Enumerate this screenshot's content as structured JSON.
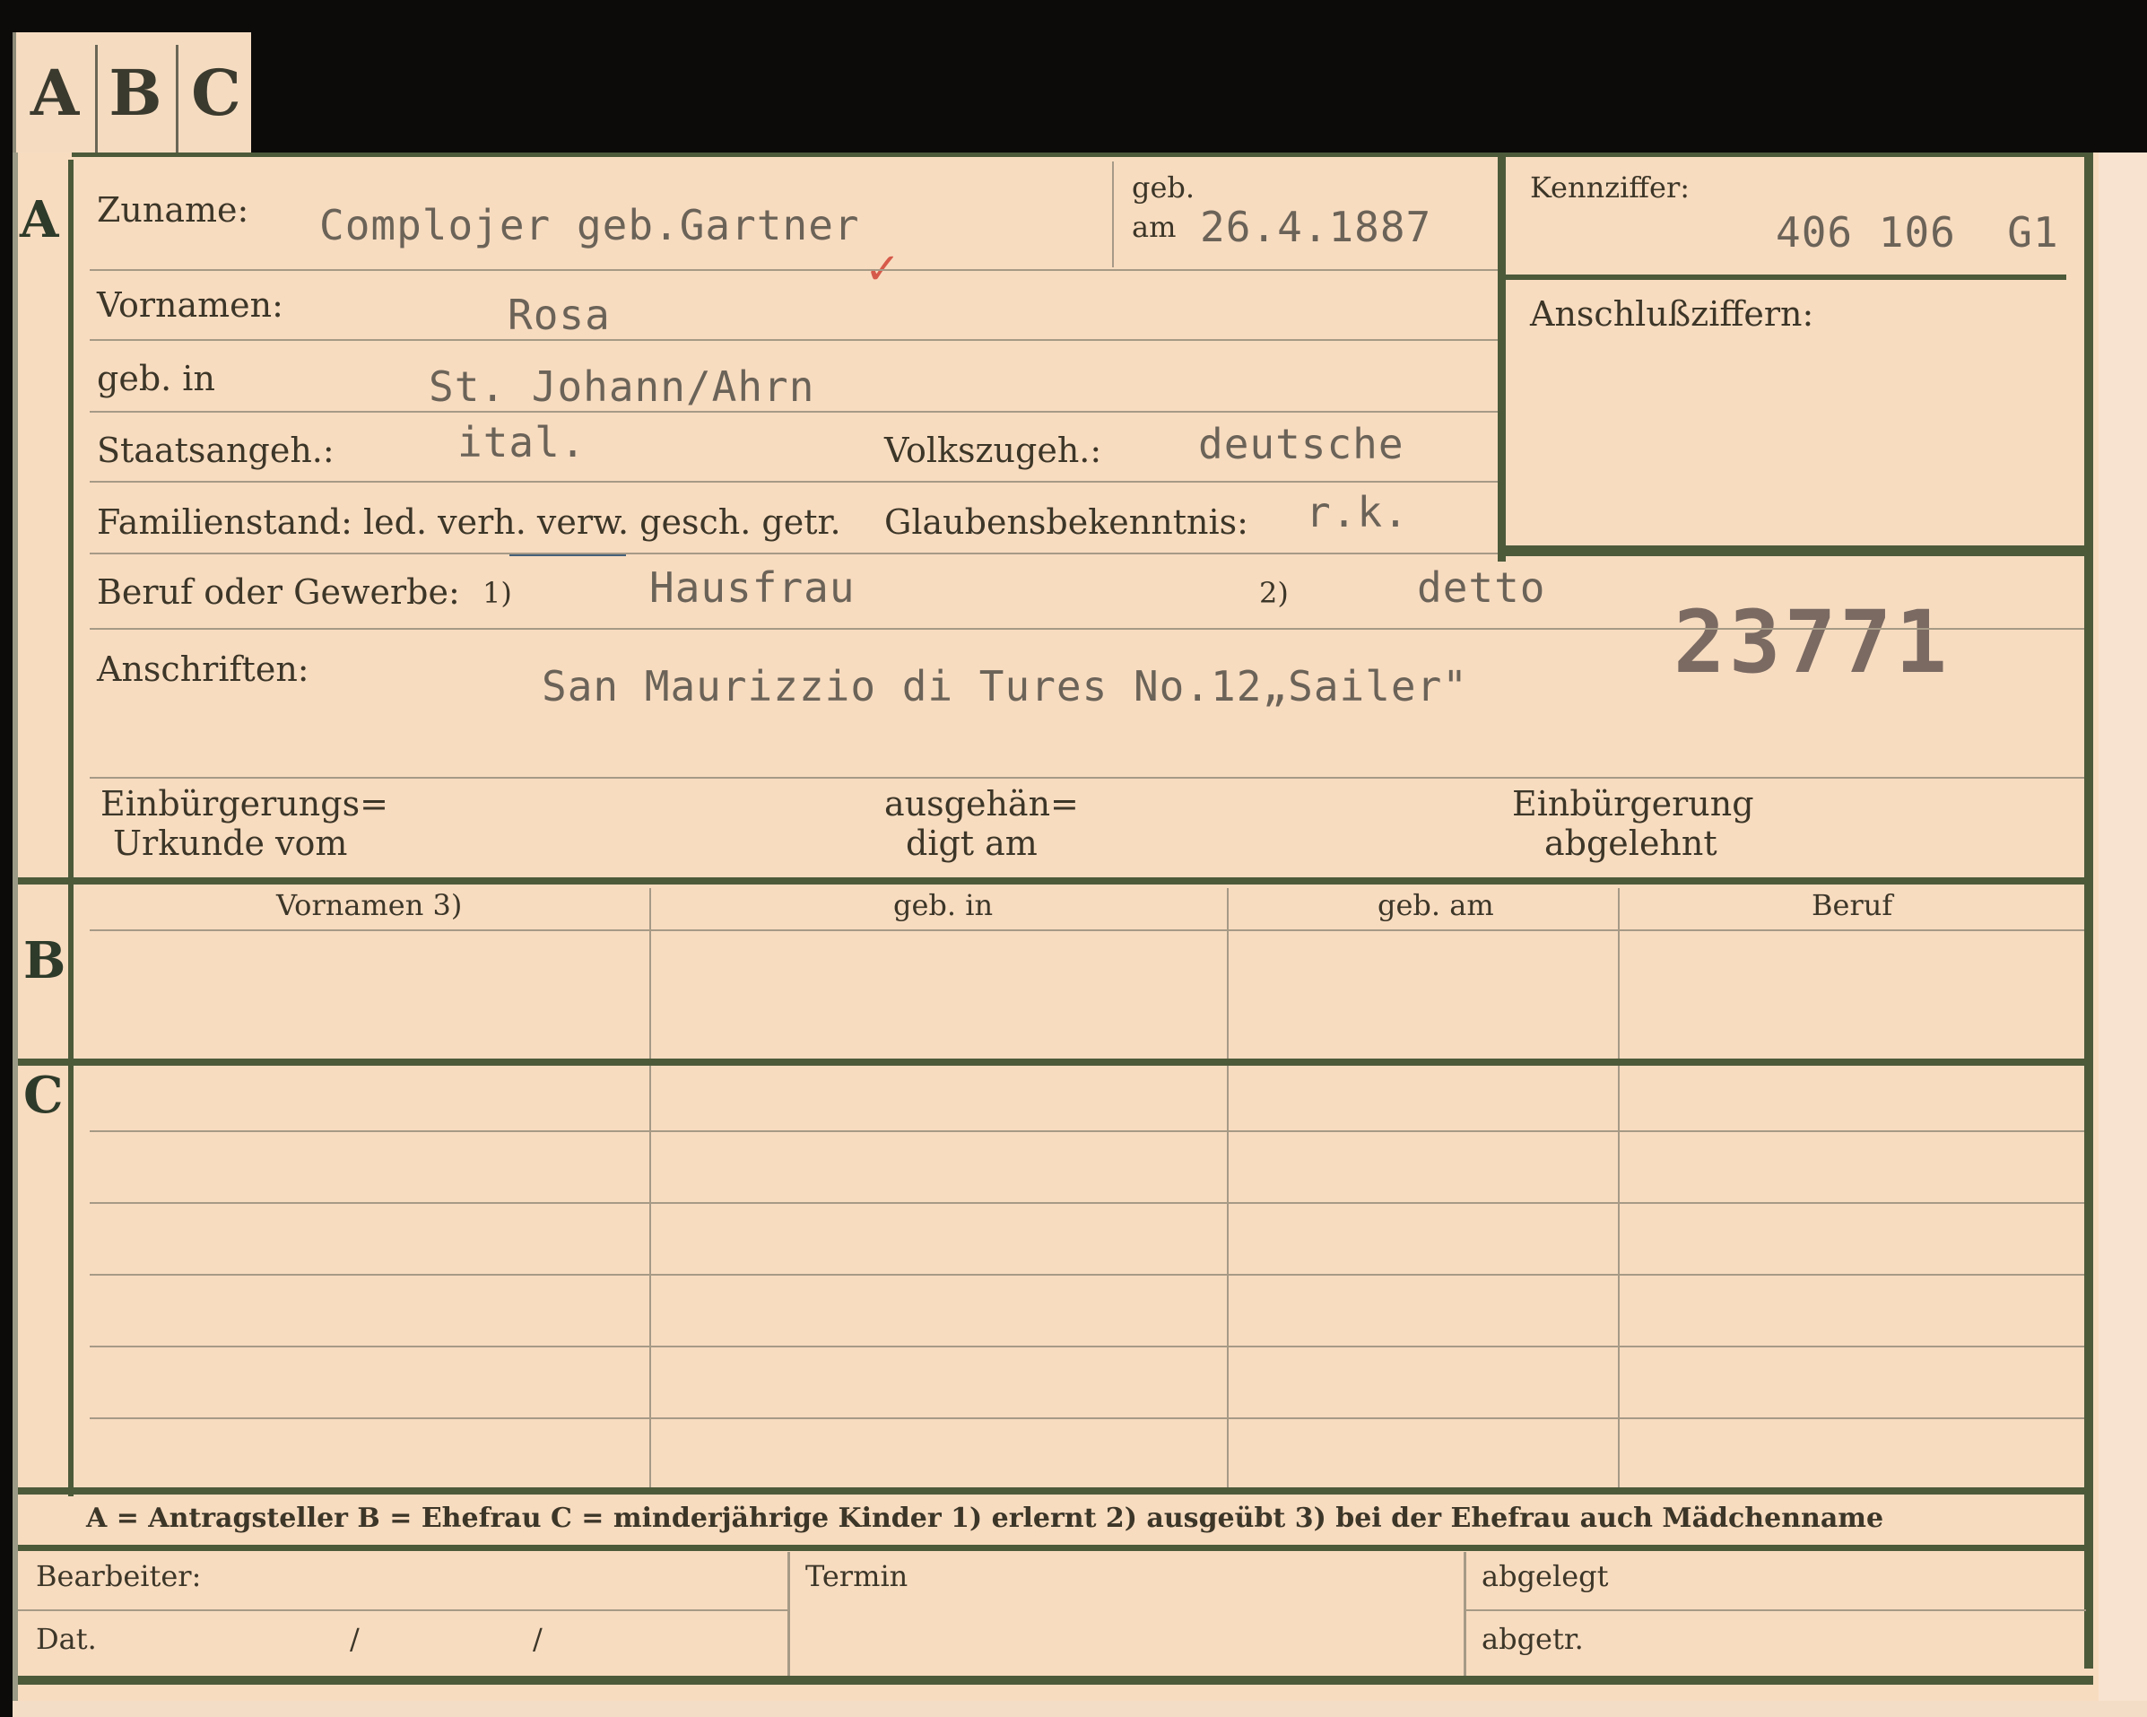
{
  "tabs": [
    "A",
    "B",
    "C"
  ],
  "sections": {
    "a": "A",
    "b": "B",
    "c": "C"
  },
  "labels": {
    "zuname": "Zuname:",
    "geb": "geb.",
    "am": "am",
    "kennziffer": "Kennziffer:",
    "anschlussziffern": "Anschlußziffern:",
    "vornamen": "Vornamen:",
    "geb_in": "geb. in",
    "staatsangeh": "Staatsangeh.:",
    "volkszugeh": "Volkszugeh.:",
    "familienstand": "Familienstand: led. verh. verw. gesch. getr.",
    "glaubensbekenntnis": "Glaubensbekenntnis:",
    "beruf_oder_gewerbe": "Beruf oder Gewerbe:",
    "note1": "1)",
    "note2": "2)",
    "anschriften": "Anschriften:",
    "einbuergerungs_urkunde_1": "Einbürgerungs=",
    "einbuergerungs_urkunde_2": "Urkunde vom",
    "ausgehaendigt_1": "ausgehän=",
    "ausgehaendigt_2": "digt am",
    "einbuergerung_abgelehnt_1": "Einbürgerung",
    "einbuergerung_abgelehnt_2": "abgelehnt"
  },
  "values": {
    "zuname": "Complojer geb.Gartner",
    "geb_am": "26.4.1887",
    "kennziffer": "406 106  G1",
    "vornamen": "Rosa",
    "geb_in": "St. Johann/Ahrn",
    "staatsangeh": "ital.",
    "volkszugeh": "deutsche",
    "glaubensbekenntnis": "r.k.",
    "beruf_1": "Hausfrau",
    "beruf_2": "detto",
    "anschrift": "San Maurizzio di Tures  No.12„Sailer\""
  },
  "stamp_number": "23771",
  "check_mark": "✓",
  "table_headers": {
    "vornamen": "Vornamen 3)",
    "geb_in": "geb. in",
    "geb_am": "geb. am",
    "beruf": "Beruf"
  },
  "legend": "A = Antragsteller   B = Ehefrau   C = minderjährige Kinder   1) erlernt   2) ausgeübt   3) bei der Ehefrau auch Mädchenname",
  "footer": {
    "bearbeiter": "Bearbeiter:",
    "dat": "Dat.",
    "slash1": "/",
    "slash2": "/",
    "termin": "Termin",
    "abgelegt": "abgelegt",
    "abgetr": "abgetr."
  }
}
